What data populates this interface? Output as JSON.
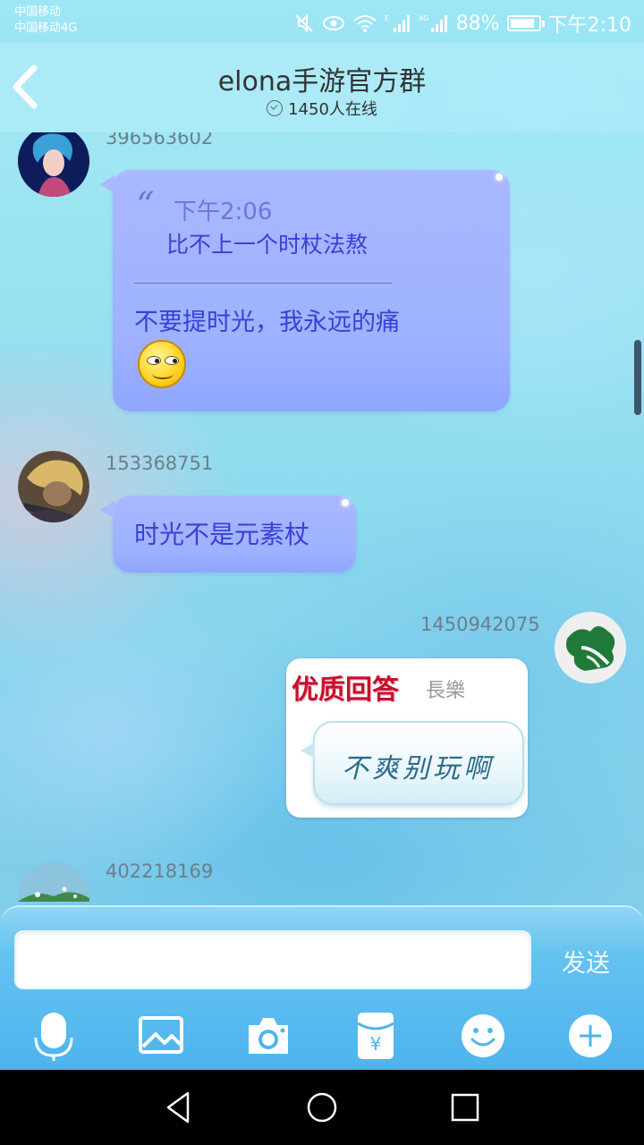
{
  "status_bar": {
    "carrier_1": "中国移动",
    "carrier_2": "中国移动4G",
    "battery": "88%",
    "battery_level": 0.88,
    "time": "下午2:10"
  },
  "header": {
    "title": "elona手游官方群",
    "online": "1450人在线"
  },
  "messages": [
    {
      "sender": "396563602",
      "quote_time": "下午2:06",
      "quote_text": "比不上一个时杖法熬",
      "text": "不要提时光，我永远的痛",
      "emoji": "smirk-emoji"
    },
    {
      "sender": "153368751",
      "text": "时光不是元素杖"
    },
    {
      "sender": "1450942075",
      "sticker_title": "优质回答",
      "sticker_sub": "長樂",
      "sticker_text": "不爽别玩啊"
    },
    {
      "sender": "402218169"
    }
  ],
  "input": {
    "value": "",
    "send_label": "发送"
  },
  "toolbar": {
    "icons": [
      "microphone-icon",
      "image-icon",
      "camera-icon",
      "red-packet-icon",
      "emoji-icon",
      "plus-icon"
    ]
  },
  "colors": {
    "bubble": "#a9b8ff",
    "bubble_text": "#3a3fd6",
    "panel": "#4eb4ee"
  }
}
